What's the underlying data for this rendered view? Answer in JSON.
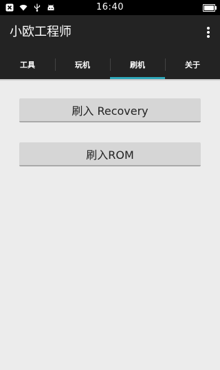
{
  "status_bar": {
    "time": "16:40",
    "icons": [
      "close-box-icon",
      "wifi-icon",
      "usb-icon",
      "android-icon"
    ]
  },
  "app_bar": {
    "title": "小欧工程师",
    "menu_icon": "overflow-menu-icon"
  },
  "tabs": [
    {
      "label": "工具",
      "active": false
    },
    {
      "label": "玩机",
      "active": false
    },
    {
      "label": "刷机",
      "active": true
    },
    {
      "label": "关于",
      "active": false
    }
  ],
  "main": {
    "buttons": [
      {
        "label": "刷入 Recovery"
      },
      {
        "label": "刷入ROM"
      }
    ]
  },
  "colors": {
    "accent": "#2fa7b9",
    "toolbar": "#232323",
    "background": "#ececec"
  }
}
